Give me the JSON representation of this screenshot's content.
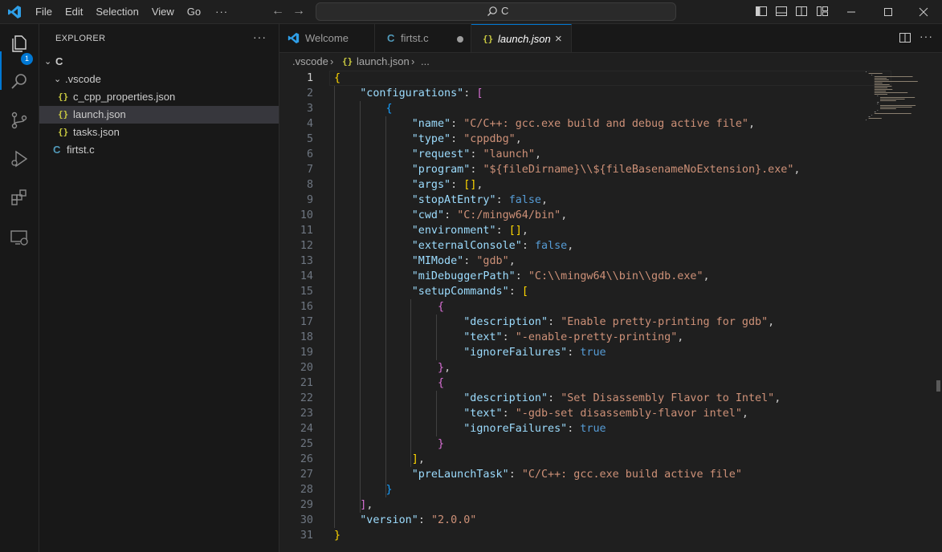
{
  "menu": {
    "items": [
      "File",
      "Edit",
      "Selection",
      "View",
      "Go"
    ],
    "more": "···"
  },
  "search": {
    "text": "C"
  },
  "activity": {
    "explorer_badge": "1"
  },
  "sidebar": {
    "title": "EXPLORER",
    "more": "···",
    "tree": [
      {
        "label": "C",
        "type": "folder",
        "depth": 0
      },
      {
        "label": ".vscode",
        "type": "folder",
        "depth": 1
      },
      {
        "label": "c_cpp_properties.json",
        "type": "json",
        "depth": 2
      },
      {
        "label": "launch.json",
        "type": "json",
        "depth": 2,
        "selected": true
      },
      {
        "label": "tasks.json",
        "type": "json",
        "depth": 2
      },
      {
        "label": "firtst.c",
        "type": "c",
        "depth": 1
      }
    ]
  },
  "tabs": [
    {
      "label": "Welcome",
      "icon": "vscode-logo-icon"
    },
    {
      "label": "firtst.c",
      "icon": "c-file-icon",
      "dirty": true
    },
    {
      "label": "launch.json",
      "icon": "json-file-icon",
      "active": true,
      "close": "×"
    }
  ],
  "breadcrumb": {
    "folder": ".vscode",
    "file": "launch.json",
    "more": "..."
  },
  "editor": {
    "current_line": 1,
    "line_numbers": [
      "1",
      "2",
      "3",
      "4",
      "5",
      "6",
      "7",
      "8",
      "9",
      "10",
      "11",
      "12",
      "13",
      "14",
      "15",
      "16",
      "17",
      "18",
      "19",
      "20",
      "21",
      "22",
      "23",
      "24",
      "25",
      "26",
      "27",
      "28",
      "29",
      "30",
      "31"
    ],
    "lines": [
      "{",
      "    \"configurations\": [",
      "        {",
      "            \"name\": \"C/C++: gcc.exe build and debug active file\",",
      "            \"type\": \"cppdbg\",",
      "            \"request\": \"launch\",",
      "            \"program\": \"${fileDirname}\\\\${fileBasenameNoExtension}.exe\",",
      "            \"args\": [],",
      "            \"stopAtEntry\": false,",
      "            \"cwd\": \"C:/mingw64/bin\",",
      "            \"environment\": [],",
      "            \"externalConsole\": false,",
      "            \"MIMode\": \"gdb\",",
      "            \"miDebuggerPath\": \"C:\\\\mingw64\\\\bin\\\\gdb.exe\",",
      "            \"setupCommands\": [",
      "                {",
      "                    \"description\": \"Enable pretty-printing for gdb\",",
      "                    \"text\": \"-enable-pretty-printing\",",
      "                    \"ignoreFailures\": true",
      "                },",
      "                {",
      "                    \"description\": \"Set Disassembly Flavor to Intel\",",
      "                    \"text\": \"-gdb-set disassembly-flavor intel\",",
      "                    \"ignoreFailures\": true",
      "                }",
      "            ],",
      "            \"preLaunchTask\": \"C/C++: gcc.exe build active file\"",
      "        }",
      "    ],",
      "    \"version\": \"2.0.0\"",
      "}"
    ]
  },
  "colors": {
    "accent": "#0078d4",
    "key": "#9cdcfe",
    "string": "#ce9178",
    "boolean": "#569cd6",
    "bracket_level1": "#ffd700",
    "bracket_level2": "#da70d6",
    "bracket_level3": "#179fff"
  }
}
